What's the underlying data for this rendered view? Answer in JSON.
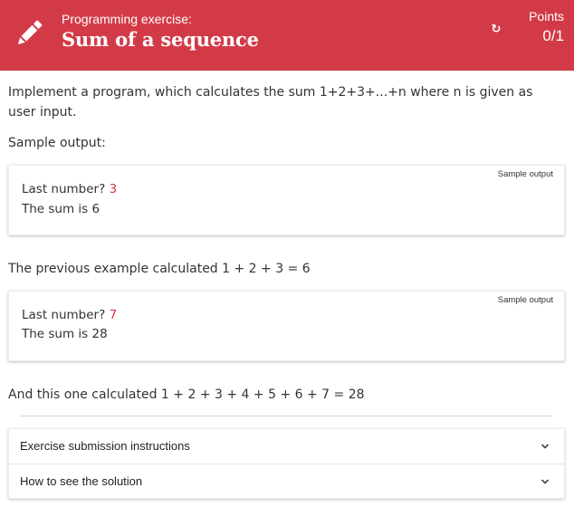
{
  "header": {
    "eyebrow": "Programming exercise:",
    "title": "Sum of a sequence",
    "points_label": "Points",
    "points_value": "0/1",
    "reset_icon": "reset-icon",
    "pencil_icon": "pencil-icon",
    "color": "#d33a47"
  },
  "content": {
    "intro": "Implement a program, which calculates the sum 1+2+3+...+n where n is given as user input.",
    "sample_heading": "Sample output:",
    "samples": [
      {
        "tag": "Sample output",
        "prompt": "Last number? ",
        "input": "3",
        "result": "The sum is 6"
      },
      {
        "tag": "Sample output",
        "prompt": "Last number? ",
        "input": "7",
        "result": "The sum is 28"
      }
    ],
    "explanation_1": "The previous example calculated 1 + 2 + 3 = 6",
    "explanation_2": "And this one calculated 1 + 2 + 3 + 4 + 5 + 6 + 7 = 28"
  },
  "accordion": [
    {
      "label": "Exercise submission instructions",
      "icon": "chevron-down-icon"
    },
    {
      "label": "How to see the solution",
      "icon": "chevron-down-icon"
    }
  ]
}
